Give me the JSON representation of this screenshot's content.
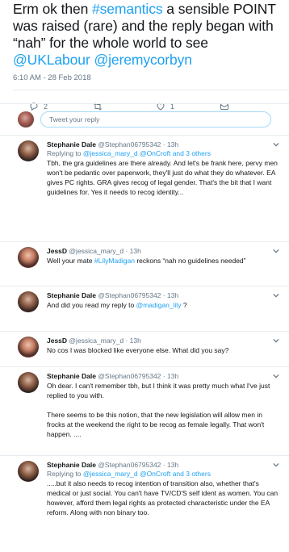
{
  "tweet": {
    "text_parts": [
      {
        "t": "Erm ok then ",
        "link": false
      },
      {
        "t": "#semantics",
        "link": true
      },
      {
        "t": " a sensible POINT was raised (rare) and the reply began with “nah” for the whole world to see ",
        "link": false
      },
      {
        "t": "@UKLabour",
        "link": true
      },
      {
        "t": " ",
        "link": false
      },
      {
        "t": "@jeremycorbyn",
        "link": true
      }
    ],
    "timestamp": "6:10 AM - 28 Feb 2018",
    "reply_count": "2",
    "retweet_count": "",
    "like_count": "1"
  },
  "reply_box": {
    "placeholder": "Tweet your reply"
  },
  "replies": [
    {
      "author": "Stephanie Dale",
      "handle": "@Stephan06795342",
      "time": "13h",
      "avatar": "stephanie",
      "replying_to": [
        "Replying to ",
        "@jessica_mary_d",
        " @OnCroft",
        " and 3 others"
      ],
      "body_parts": [
        {
          "t": "Tbh, the gra guidelines are there already. And let's be frank here, pervy men won't be pedantic over paperwork, they'll just do what they do whatever. EA gives PC rights. GRA gives recog of legal gender. That's the bit that I want guidelines for. Yes it needs to recog identity...",
          "link": false
        }
      ]
    },
    {
      "author": "JessD",
      "handle": "@jessica_mary_d",
      "time": "13h",
      "avatar": "jess",
      "replying_to": null,
      "body_parts": [
        {
          "t": "Well your mate ",
          "link": false
        },
        {
          "t": "#LilyMadigan",
          "link": true
        },
        {
          "t": " reckons “nah no guidelines needed”",
          "link": false
        }
      ]
    },
    {
      "author": "Stephanie Dale",
      "handle": "@Stephan06795342",
      "time": "13h",
      "avatar": "stephanie",
      "replying_to": null,
      "body_parts": [
        {
          "t": "And did you read my reply to ",
          "link": false
        },
        {
          "t": "@madigan_lily",
          "link": true
        },
        {
          "t": " ?",
          "link": false
        }
      ]
    },
    {
      "author": "JessD",
      "handle": "@jessica_mary_d",
      "time": "13h",
      "avatar": "jess",
      "replying_to": null,
      "body_parts": [
        {
          "t": "No cos I was blocked like everyone else. What did you say?",
          "link": false
        }
      ]
    },
    {
      "author": "Stephanie Dale",
      "handle": "@Stephan06795342",
      "time": "13h",
      "avatar": "stephanie",
      "replying_to": null,
      "body_parts": [
        {
          "t": "Oh dear. I can't remember tbh, but I think it was pretty much what I've just replied to you with.\n\nThere seems to be this notion, that the new legislation will allow men in frocks at the weekend the right to be recog as female legally. That won't happen. ....",
          "link": false
        }
      ]
    },
    {
      "author": "Stephanie Dale",
      "handle": "@Stephan06795342",
      "time": "13h",
      "avatar": "stephanie",
      "replying_to": [
        "Replying to ",
        "@jessica_mary_d",
        " @OnCroft",
        " and 3 others"
      ],
      "body_parts": [
        {
          "t": ".....but it also needs to recog intention of transition also, whether that's medical or just social. You can't have TV/CD'S self ident as women. You can however, afford them legal rights as protected characteristic under the EA reform. Along with non binary too.",
          "link": false
        }
      ]
    }
  ]
}
